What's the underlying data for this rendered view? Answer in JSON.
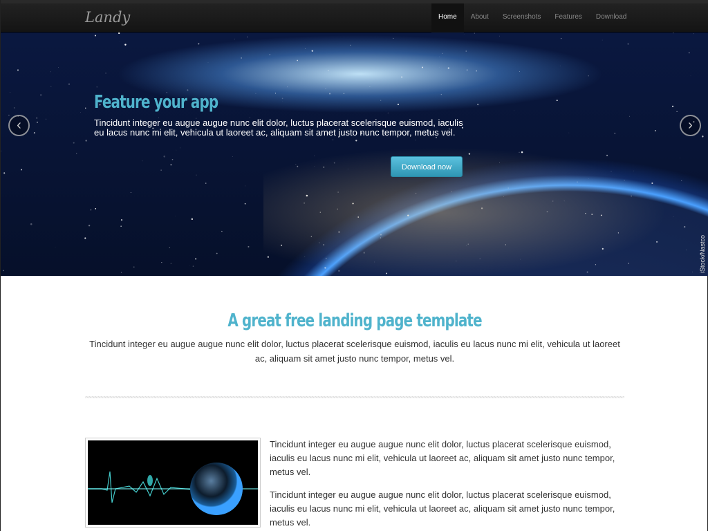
{
  "nav": {
    "brand": "Landy",
    "items": [
      {
        "label": "Home",
        "active": true
      },
      {
        "label": "About"
      },
      {
        "label": "Screenshots"
      },
      {
        "label": "Features"
      },
      {
        "label": "Download"
      }
    ]
  },
  "hero": {
    "title": "Feature your app",
    "text": "Tincidunt integer eu augue augue nunc elit dolor, luctus placerat scelerisque euismod, iaculis eu lacus nunc mi elit, vehicula ut laoreet ac, aliquam sit amet justo nunc tempor, metus vel.",
    "button": "Download now",
    "credit": "iStock/Nastco",
    "prev_icon": "chevron-left-icon",
    "next_icon": "chevron-right-icon"
  },
  "intro": {
    "title": "A great free landing page template",
    "text": "Tincidunt integer eu augue augue nunc elit dolor, luctus placerat scelerisque euismod, iaculis eu lacus nunc mi elit, vehicula ut laoreet ac, aliquam sit amet justo nunc tempor, metus vel."
  },
  "feature": {
    "paragraphs": [
      "Tincidunt integer eu augue augue nunc elit dolor, luctus placerat scelerisque euismod, iaculis eu lacus nunc mi elit, vehicula ut laoreet ac, aliquam sit amet justo nunc tempor, metus vel.",
      "Tincidunt integer eu augue augue nunc elit dolor, luctus placerat scelerisque euismod, iaculis eu lacus nunc mi elit, vehicula ut laoreet ac, aliquam sit amet justo nunc tempor, metus vel."
    ]
  },
  "colors": {
    "accent": "#4fb3cc",
    "button": "#49afcd",
    "navbar": "#1b1b1b"
  }
}
